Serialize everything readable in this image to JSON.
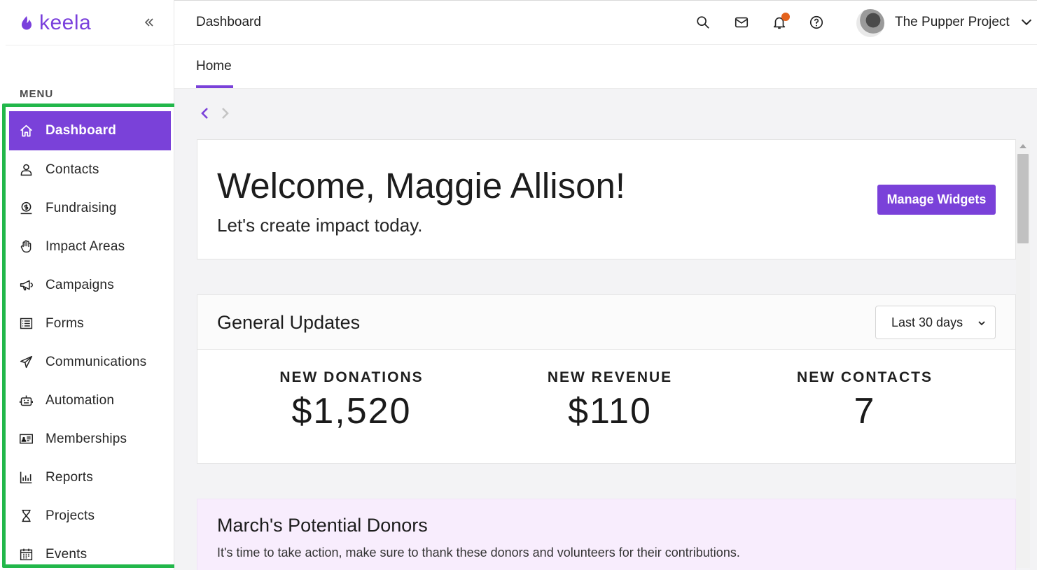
{
  "app": {
    "logo_text": "keela",
    "brand_color": "#7a41d9"
  },
  "sidebar": {
    "menu_heading": "MENU",
    "items": [
      {
        "label": "Dashboard",
        "icon": "home-icon",
        "active": true
      },
      {
        "label": "Contacts",
        "icon": "user-icon"
      },
      {
        "label": "Fundraising",
        "icon": "dollar-badge-icon"
      },
      {
        "label": "Impact Areas",
        "icon": "hand-icon"
      },
      {
        "label": "Campaigns",
        "icon": "megaphone-icon"
      },
      {
        "label": "Forms",
        "icon": "list-form-icon"
      },
      {
        "label": "Communications",
        "icon": "paper-plane-icon"
      },
      {
        "label": "Automation",
        "icon": "robot-icon"
      },
      {
        "label": "Memberships",
        "icon": "id-card-icon"
      },
      {
        "label": "Reports",
        "icon": "bar-chart-icon"
      },
      {
        "label": "Projects",
        "icon": "hourglass-icon"
      },
      {
        "label": "Events",
        "icon": "calendar-icon"
      }
    ]
  },
  "header": {
    "title": "Dashboard",
    "org_name": "The Pupper Project",
    "notification_dot_color": "#e4621c"
  },
  "tabs": {
    "home": "Home"
  },
  "welcome": {
    "title": "Welcome, Maggie Allison!",
    "subtitle": "Let's create impact today.",
    "manage_button": "Manage Widgets"
  },
  "updates": {
    "title": "General Updates",
    "range": "Last 30 days",
    "stats": [
      {
        "label": "NEW DONATIONS",
        "value": "$1,520"
      },
      {
        "label": "NEW REVENUE",
        "value": "$110"
      },
      {
        "label": "NEW CONTACTS",
        "value": "7"
      }
    ]
  },
  "donors": {
    "title": "March's Potential Donors",
    "subtitle": "It's time to take action, make sure to thank these donors and volunteers for their contributions."
  }
}
